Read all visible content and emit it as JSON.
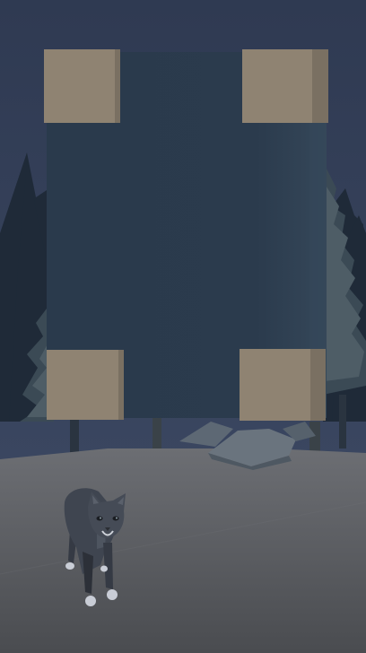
{
  "scene": {
    "colors": {
      "sky_top": "#2f3a52",
      "sky_bottom": "#3a4660",
      "tree_dark": "#1f2a38",
      "tree_mid": "#3b4a55",
      "tree_light": "#4e5d66",
      "ground_top": "#6c6e73",
      "ground_bottom": "#4a4c50",
      "panel": "#2b3b4d",
      "panel_edge": "#35475a",
      "frame_block": "#8f8372",
      "frame_block_shade": "#7a7062",
      "rock": "#5d6874",
      "cat_body": "#3f4550",
      "cat_paws": "#c9cdd6"
    },
    "elements": {
      "trees": "pine-trees",
      "panel": "dark-panel",
      "frame_blocks": "corner-blocks",
      "rocks": "flat-rocks",
      "cat": "cat-character"
    }
  }
}
